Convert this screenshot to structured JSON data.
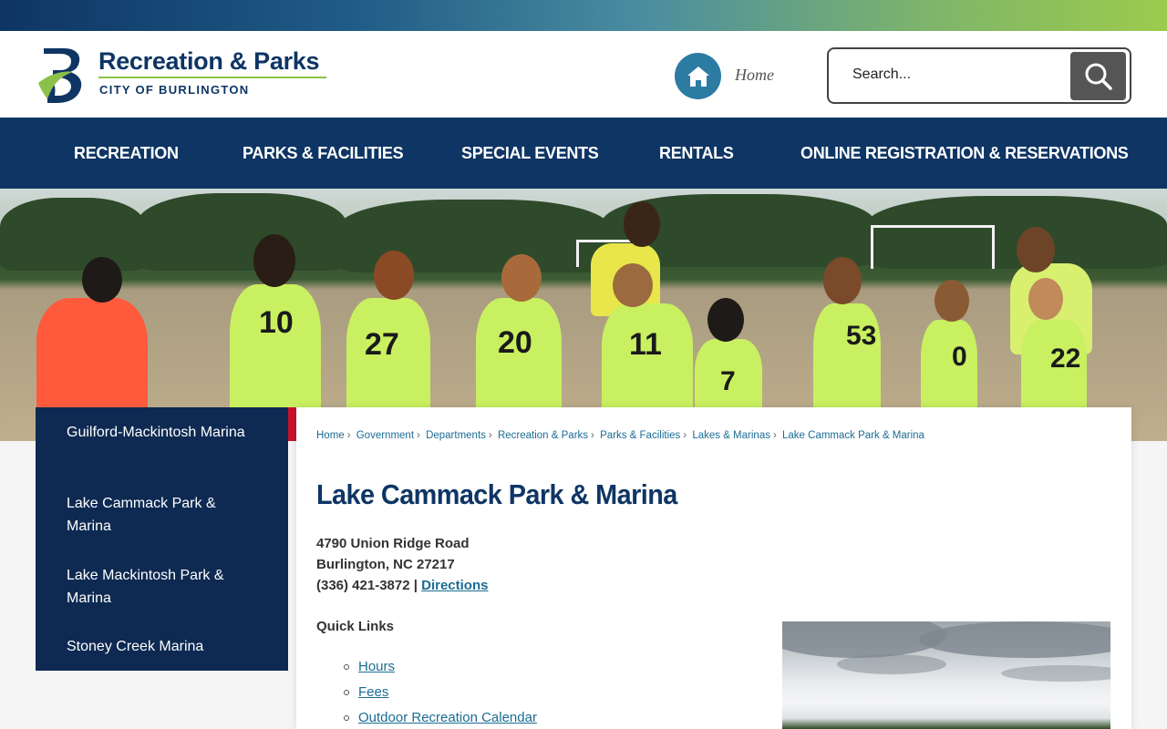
{
  "header": {
    "logo_title": "Recreation & Parks",
    "logo_subtitle": "CITY OF BURLINGTON",
    "home_label": "Home",
    "search_placeholder": "Search..."
  },
  "nav": {
    "items": [
      {
        "label": "RECREATION"
      },
      {
        "label": "PARKS & FACILITIES"
      },
      {
        "label": "SPECIAL EVENTS"
      },
      {
        "label": "RENTALS"
      },
      {
        "label": "ONLINE REGISTRATION & RESERVATIONS"
      }
    ]
  },
  "hero": {
    "jersey_numbers": [
      "10",
      "27",
      "20",
      "11",
      "7",
      "53",
      "0",
      "22"
    ]
  },
  "sidebar": {
    "items": [
      {
        "label": "Guilford-Mackintosh Marina"
      },
      {
        "label": "Lake Cammack Park & Marina"
      },
      {
        "label": "Lake Mackintosh Park & Marina"
      },
      {
        "label": "Stoney Creek Marina"
      }
    ]
  },
  "breadcrumb": {
    "items": [
      "Home",
      "Government",
      "Departments",
      "Recreation & Parks",
      "Parks & Facilities",
      "Lakes & Marinas",
      "Lake Cammack Park & Marina"
    ],
    "separator": "›"
  },
  "main": {
    "title": "Lake Cammack Park & Marina",
    "address_line1": "4790 Union Ridge Road",
    "address_line2": "Burlington, NC 27217",
    "phone": "(336) 421-3872 |",
    "directions_label": "Directions",
    "quick_links_title": "Quick Links",
    "quick_links": [
      "Hours",
      "Fees",
      "Outdoor Recreation Calendar"
    ]
  },
  "colors": {
    "navy": "#0e3564",
    "sidebar_navy": "#0e2a52",
    "link_blue": "#1a6d94",
    "accent_green": "#8cc04a",
    "accent_red": "#c8102e"
  },
  "icons": [
    "burlington-logo-icon",
    "home-icon",
    "search-icon"
  ]
}
